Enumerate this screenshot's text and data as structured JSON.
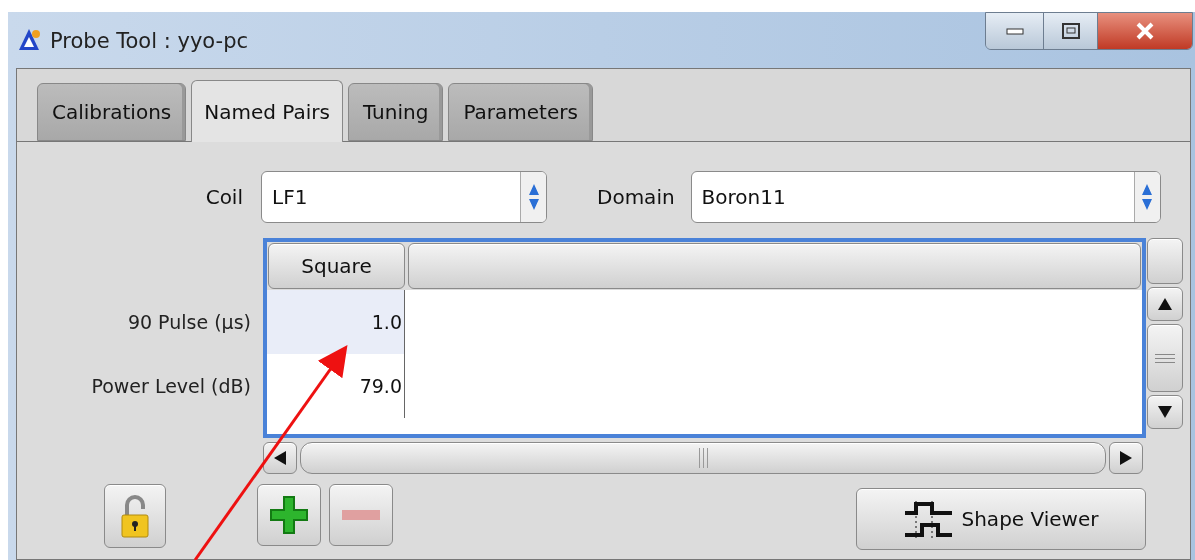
{
  "window": {
    "title": "Probe Tool : yyo-pc"
  },
  "tabs": [
    {
      "label": "Calibrations",
      "selected": false
    },
    {
      "label": "Named Pairs",
      "selected": true
    },
    {
      "label": "Tuning",
      "selected": false
    },
    {
      "label": "Parameters",
      "selected": false
    }
  ],
  "coil": {
    "label": "Coil",
    "value": "LF1"
  },
  "domain": {
    "label": "Domain",
    "value": "Boron11"
  },
  "table": {
    "column_header": "Square",
    "rows": [
      {
        "label": "90 Pulse (µs)",
        "value": "1.0",
        "selected": true
      },
      {
        "label": "Power Level (dB)",
        "value": "79.0",
        "selected": false
      }
    ]
  },
  "lock": {
    "locked": false
  },
  "add_button": {
    "disabled": false
  },
  "remove_button": {
    "disabled": true
  },
  "shape_viewer_button": {
    "label": "Shape Viewer"
  }
}
